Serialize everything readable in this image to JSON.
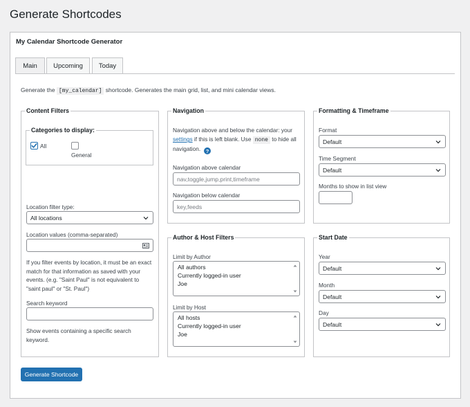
{
  "page_title": "Generate Shortcodes",
  "panel_title": "My Calendar Shortcode Generator",
  "tabs": [
    {
      "label": "Main"
    },
    {
      "label": "Upcoming"
    },
    {
      "label": "Today"
    }
  ],
  "intro": {
    "before": "Generate the",
    "code": "[my_calendar]",
    "after": "shortcode. Generates the main grid, list, and mini calendar views."
  },
  "content_filters": {
    "legend": "Content Filters",
    "categories": {
      "legend": "Categories to display:",
      "all_label": "All",
      "all_checked": true,
      "general_label": "General",
      "general_checked": false
    },
    "location_type_label": "Location filter type:",
    "location_type_value": "All locations",
    "location_values_label": "Location values (comma-separated)",
    "location_values_value": "",
    "location_help_lines": [
      "If you filter events by location, it must be an exact",
      "match for that information as saved with your",
      "events. (e.g. \"Saint Paul\" is not equivalent to",
      "\"saint paul\" or \"St. Paul\")"
    ],
    "search_label": "Search keyword",
    "search_value": "",
    "search_help_lines": [
      "Show events containing a specific search",
      "keyword."
    ]
  },
  "navigation": {
    "legend": "Navigation",
    "desc_line1": "Navigation above and below the calendar: your",
    "desc_link": "settings",
    "desc_line2_mid": " if this is left blank. Use ",
    "desc_code": "none",
    "desc_line2_end": " to hide all",
    "desc_line3": "navigation.",
    "help_glyph": "?",
    "above_label": "Navigation above calendar",
    "above_placeholder": "nav,toggle,jump,print,timeframe",
    "below_label": "Navigation below calendar",
    "below_placeholder": "key,feeds"
  },
  "formatting": {
    "legend": "Formatting & Timeframe",
    "format_label": "Format",
    "format_value": "Default",
    "segment_label": "Time Segment",
    "segment_value": "Default",
    "months_label": "Months to show in list view",
    "months_value": ""
  },
  "author_host": {
    "legend": "Author & Host Filters",
    "author_label": "Limit by Author",
    "author_options": [
      "All authors",
      "Currently logged-in user",
      "Joe"
    ],
    "host_label": "Limit by Host",
    "host_options": [
      "All hosts",
      "Currently logged-in user",
      "Joe"
    ]
  },
  "start_date": {
    "legend": "Start Date",
    "year_label": "Year",
    "year_value": "Default",
    "month_label": "Month",
    "month_value": "Default",
    "day_label": "Day",
    "day_value": "Default"
  },
  "generate_button": "Generate Shortcode",
  "colors": {
    "accent": "#2271b1",
    "border": "#c3c4c7",
    "background": "#f0f0f1"
  }
}
